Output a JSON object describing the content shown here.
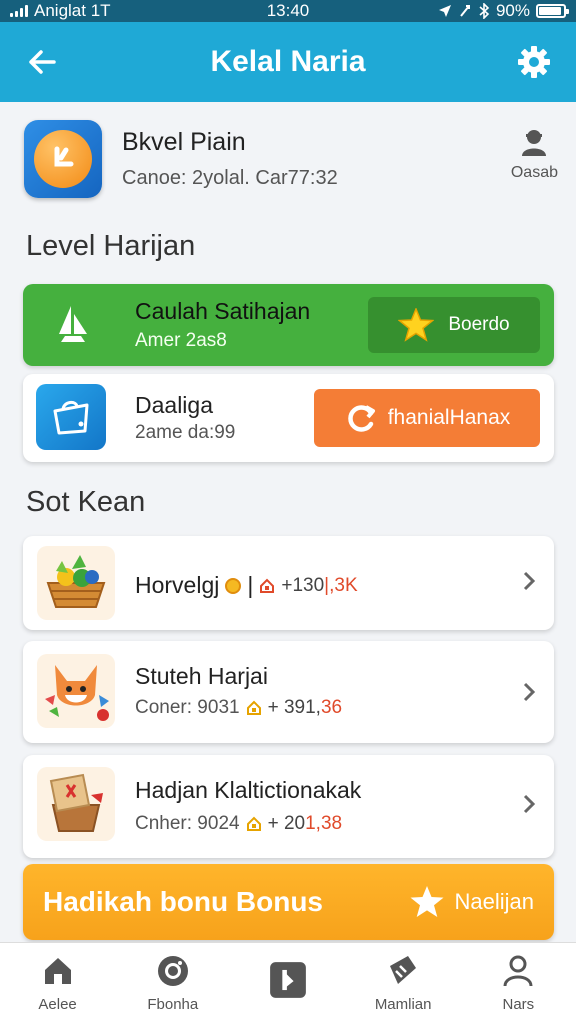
{
  "status_bar": {
    "carrier": "Aniglat 1T",
    "time": "13:40",
    "battery": "90%",
    "battery_level": 0.9
  },
  "app_bar": {
    "title": "Kelal Naria"
  },
  "profile": {
    "name": "Bkvel Piain",
    "subtitle": "Canoe: 2yolal. Car77:32",
    "user_label": "Oasab"
  },
  "level_section": {
    "title": "Level Harijan",
    "green_card": {
      "title": "Caulah Satihajan",
      "subtitle": "Amer 2as8",
      "button_label": "Boerdo"
    },
    "blue_card": {
      "title": "Daaliga",
      "subtitle": "2ame da:99",
      "button_label": "fhanialHanax"
    }
  },
  "soft_section": {
    "title": "Sot Kean",
    "items": [
      {
        "title": "Horvelgj",
        "title_suffix": "|",
        "reward_prefix": "+130",
        "reward_highlight": "|,3K"
      },
      {
        "title": "Stuteh Harjai",
        "subtitle": "Coner: 9031",
        "reward_prefix": "+ 391,",
        "reward_highlight": "36"
      },
      {
        "title": "Hadjan Klaltictionakak",
        "subtitle": "Cnher: 9024",
        "reward_prefix": "+ 20",
        "reward_highlight": "1,38"
      }
    ]
  },
  "bonus_banner": {
    "label": "Hadikah bonu Bonus",
    "action_label": "Naelijan"
  },
  "bottom_nav": [
    {
      "label": "Aelee",
      "icon": "home-icon"
    },
    {
      "label": "Fbonha",
      "icon": "camera-icon"
    },
    {
      "label": "",
      "icon": "play-square-icon"
    },
    {
      "label": "Mamlian",
      "icon": "ticket-icon"
    },
    {
      "label": "Nars",
      "icon": "person-icon"
    }
  ],
  "colors": {
    "header": "#1fa9d6",
    "status_bar": "#16607d",
    "green": "#45b03e",
    "orange": "#f47d36",
    "banner": "#f7a21b"
  }
}
